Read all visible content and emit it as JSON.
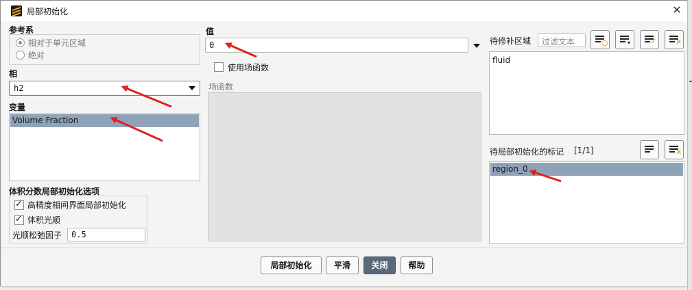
{
  "window": {
    "title": "局部初始化"
  },
  "reference_frame": {
    "label": "参考系",
    "options": [
      {
        "label": "相对于单元区域",
        "selected": true
      },
      {
        "label": "绝对",
        "selected": false
      }
    ]
  },
  "phase": {
    "label": "相",
    "value": "h2"
  },
  "variable": {
    "label": "变量",
    "items": [
      "Volume Fraction"
    ]
  },
  "vof_options": {
    "label": "体积分数局部初始化选项",
    "high_res": {
      "label": "高精度相间界面局部初始化",
      "checked": true
    },
    "vol_smooth": {
      "label": "体积光顺",
      "checked": true
    },
    "relax": {
      "label": "光顺松弛因子",
      "value": "0.5"
    }
  },
  "value": {
    "label": "值",
    "input": "0"
  },
  "field_function": {
    "use_label": "使用场函数",
    "checked": false,
    "list_label": "场函数"
  },
  "zones": {
    "label": "待修补区域",
    "filter_placeholder": "过滤文本",
    "items": [
      "fluid"
    ]
  },
  "registers": {
    "label": "待局部初始化的标记",
    "count": "[1/1]",
    "items": [
      "region_0"
    ]
  },
  "buttons": {
    "patch": "局部初始化",
    "smooth": "平滑",
    "close": "关闭",
    "help": "帮助"
  },
  "colors": {
    "selection": "#8fa3b8",
    "arrow": "#e02020",
    "primary_button": "#5b6a7a"
  }
}
